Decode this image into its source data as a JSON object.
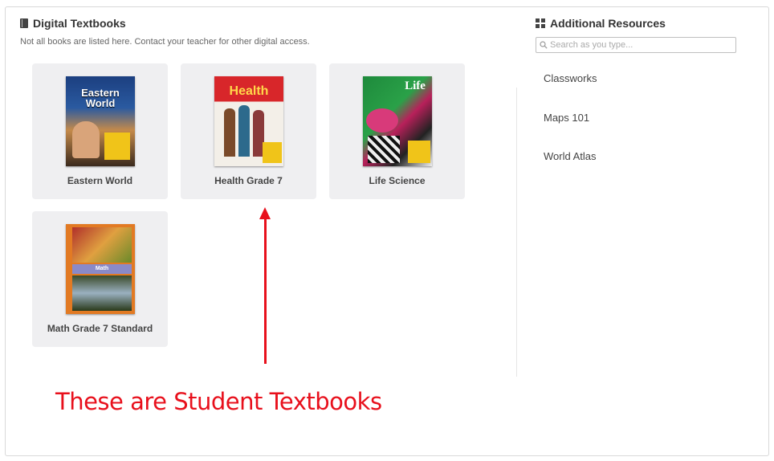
{
  "digital_textbooks": {
    "title": "Digital Textbooks",
    "subtitle": "Not all books are listed here. Contact your teacher for other digital access.",
    "books": [
      {
        "label": "Eastern World",
        "cover_text": "Eastern World",
        "cover_color": "#2a5aa0"
      },
      {
        "label": "Health Grade 7",
        "cover_text": "Health",
        "cover_color": "#d8262a"
      },
      {
        "label": "Life Science",
        "cover_text": "Life",
        "cover_color": "#1e8a3c"
      },
      {
        "label": "Math Grade 7 Standard",
        "cover_text": "Math",
        "cover_color": "#e27a23"
      }
    ]
  },
  "additional_resources": {
    "title": "Additional Resources",
    "search_placeholder": "Search as you type...",
    "items": [
      {
        "label": "Classworks"
      },
      {
        "label": "Maps 101"
      },
      {
        "label": "World Atlas"
      }
    ]
  },
  "annotation": {
    "caption": "These are Student Textbooks",
    "color": "#e8101c"
  }
}
